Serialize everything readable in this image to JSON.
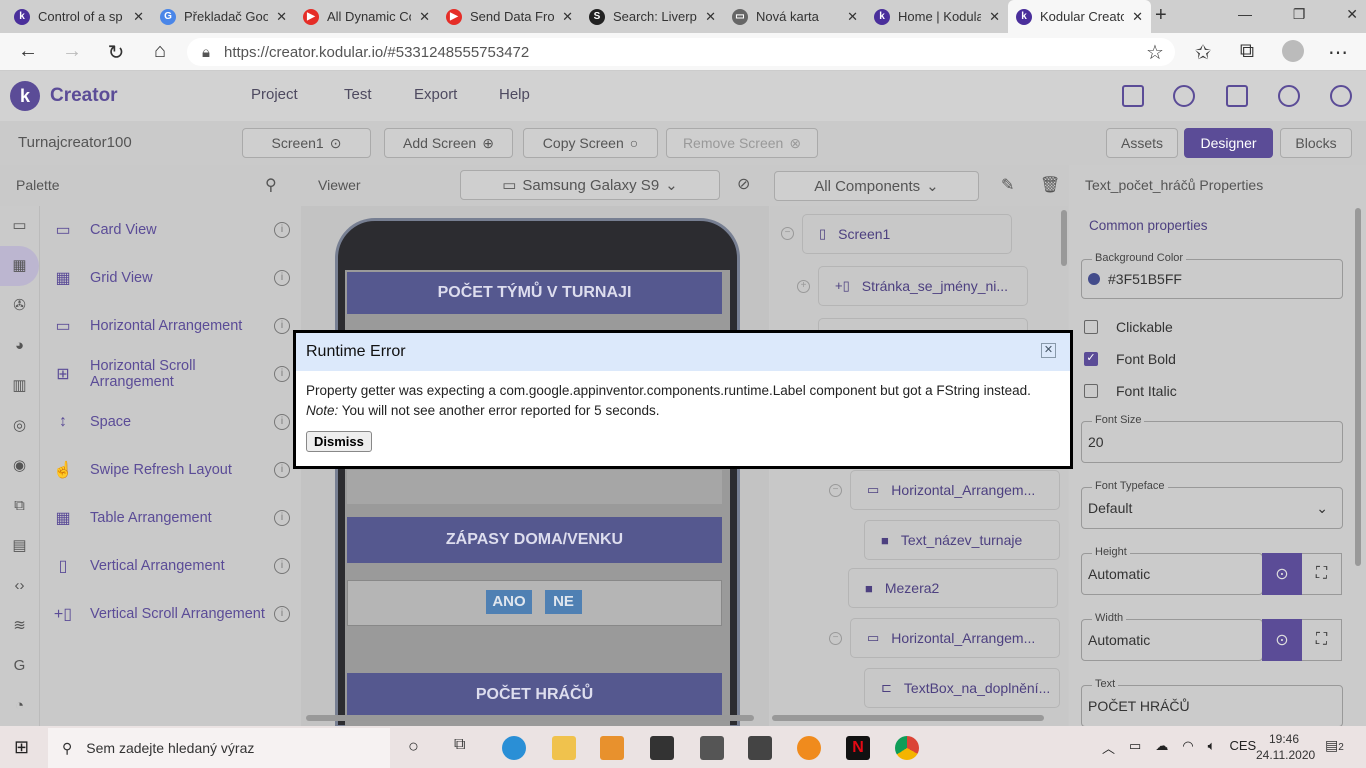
{
  "browser": {
    "tabs": [
      {
        "title": "Control of a sp",
        "fav": "k",
        "color": "#4a2f9b"
      },
      {
        "title": "Překladač Goo",
        "fav": "G",
        "color": "#4a86e8"
      },
      {
        "title": "All Dynamic Co",
        "fav": "▶",
        "color": "#e52d27"
      },
      {
        "title": "Send Data Fro",
        "fav": "▶",
        "color": "#e52d27"
      },
      {
        "title": "Search: Liverpo",
        "fav": "S",
        "color": "#222222"
      },
      {
        "title": "Nová karta",
        "fav": "▭",
        "color": "#666666"
      },
      {
        "title": "Home | Kodula",
        "fav": "k",
        "color": "#4a2f9b"
      },
      {
        "title": "Kodular Creato",
        "fav": "k",
        "color": "#4a2f9b"
      }
    ],
    "url": "https://creator.kodular.io/#5331248555753472"
  },
  "app": {
    "brand": "Creator",
    "menu": [
      "Project",
      "Test",
      "Export",
      "Help"
    ],
    "project_name": "Turnajcreator100",
    "screen_select": "Screen1",
    "add_screen": "Add Screen",
    "copy_screen": "Copy Screen",
    "remove_screen": "Remove Screen",
    "assets": "Assets",
    "designer": "Designer",
    "blocks": "Blocks",
    "accent": "#5B4C97"
  },
  "palette": {
    "title": "Palette",
    "items": [
      {
        "label": "Card View",
        "icon": "▭"
      },
      {
        "label": "Grid View",
        "icon": "▦"
      },
      {
        "label": "Horizontal Arrangement",
        "icon": "▭"
      },
      {
        "label": "Horizontal Scroll Arrangement",
        "icon": "⊞"
      },
      {
        "label": "Space",
        "icon": "↕"
      },
      {
        "label": "Swipe Refresh Layout",
        "icon": "☝"
      },
      {
        "label": "Table Arrangement",
        "icon": "▦"
      },
      {
        "label": "Vertical Arrangement",
        "icon": "▯"
      },
      {
        "label": "Vertical Scroll Arrangement",
        "icon": "+▯"
      }
    ]
  },
  "viewer": {
    "title": "Viewer",
    "device": "Samsung Galaxy S9",
    "blocks": [
      "POČET TÝMŮ V TURNAJI",
      "ZÁPASY DOMA/VENKU",
      "POČET HRÁČŮ"
    ],
    "ano": "ANO",
    "ne": "NE"
  },
  "tree": {
    "filter": "All Components",
    "nodes": [
      "Screen1",
      "Stránka_se_jmény_ni...",
      "Horizontal_Arrangem...",
      "Text_název_turnaje",
      "Mezera2",
      "Horizontal_Arrangem...",
      "TextBox_na_doplnění..."
    ]
  },
  "props": {
    "title": "Text_počet_hráčů Properties",
    "common": "Common properties",
    "bg_label": "Background Color",
    "bg_value": "#3F51B5FF",
    "bg_swatch": "#3F51B5",
    "clickable": "Clickable",
    "bold": "Font Bold",
    "italic": "Font Italic",
    "font_size_label": "Font Size",
    "font_size": "20",
    "typeface_label": "Font Typeface",
    "typeface": "Default",
    "height_label": "Height",
    "height": "Automatic",
    "width_label": "Width",
    "width": "Automatic",
    "text_label": "Text",
    "text": "POČET HRÁČŮ"
  },
  "dialog": {
    "title": "Runtime Error",
    "message": "Property getter was expecting a com.google.appinventor.components.runtime.Label component but got a FString instead.",
    "note_label": "Note:",
    "note": " You will not see another error reported for 5 seconds.",
    "dismiss": "Dismiss"
  },
  "taskbar": {
    "search_placeholder": "Sem zadejte hledaný výraz",
    "lang": "CES",
    "time": "19:46",
    "date": "24.11.2020",
    "notifications": "2"
  }
}
